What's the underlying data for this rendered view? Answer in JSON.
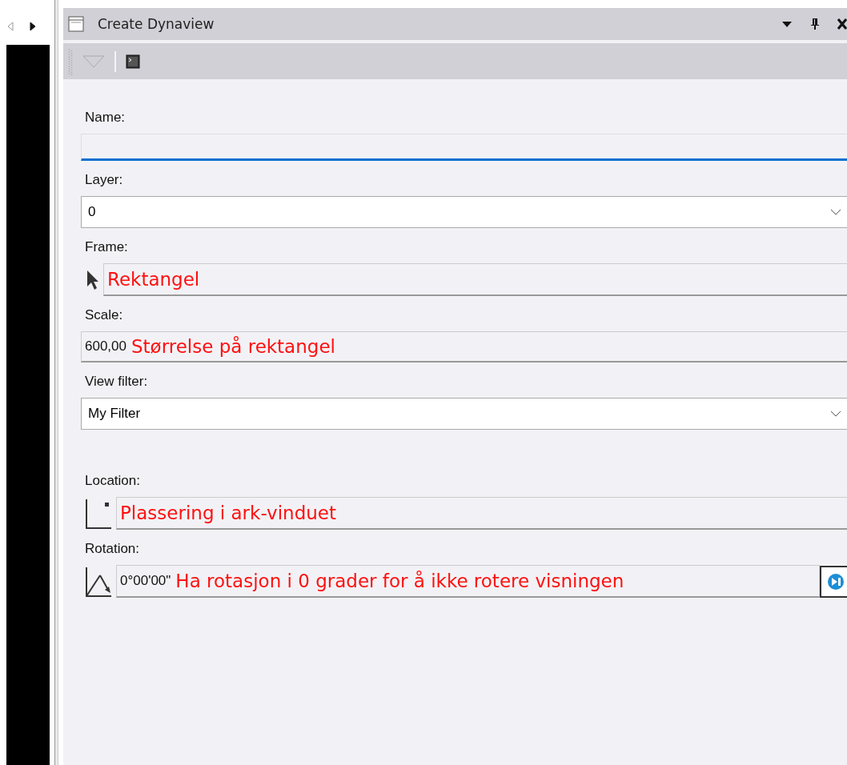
{
  "nav_buttons": [
    {
      "kind": "left",
      "disabled": true
    },
    {
      "kind": "right",
      "disabled": false
    }
  ],
  "window": {
    "title": "Create Dynaview"
  },
  "fields": [
    {
      "label": "Name:",
      "kind": "text",
      "focused": true
    },
    {
      "label": "Layer:",
      "kind": "dropdown",
      "value": "0"
    },
    {
      "label": "Frame:",
      "kind": "pick",
      "note": "Rektangel"
    },
    {
      "label": "Scale:",
      "kind": "value",
      "value": "600,00",
      "note": "Størrelse på rektangel"
    },
    {
      "label": "View filter:",
      "kind": "dropdown",
      "value": "My Filter"
    },
    {
      "label": "Location:",
      "kind": "location",
      "note": "Plassering i ark-vinduet"
    },
    {
      "label": "Rotation:",
      "kind": "rotation",
      "value": "0°00'00\"",
      "note": "Ha rotasjon i 0 grader for å ikke rotere visningen"
    }
  ]
}
